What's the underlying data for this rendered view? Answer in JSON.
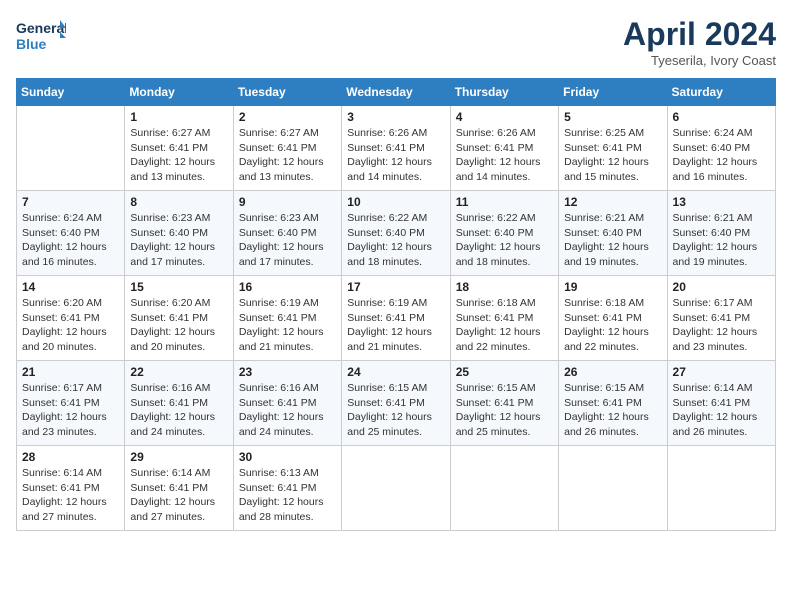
{
  "header": {
    "logo_line1": "General",
    "logo_line2": "Blue",
    "month": "April 2024",
    "location": "Tyeserila, Ivory Coast"
  },
  "weekdays": [
    "Sunday",
    "Monday",
    "Tuesday",
    "Wednesday",
    "Thursday",
    "Friday",
    "Saturday"
  ],
  "weeks": [
    [
      {
        "day": "",
        "info": ""
      },
      {
        "day": "1",
        "info": "Sunrise: 6:27 AM\nSunset: 6:41 PM\nDaylight: 12 hours\nand 13 minutes."
      },
      {
        "day": "2",
        "info": "Sunrise: 6:27 AM\nSunset: 6:41 PM\nDaylight: 12 hours\nand 13 minutes."
      },
      {
        "day": "3",
        "info": "Sunrise: 6:26 AM\nSunset: 6:41 PM\nDaylight: 12 hours\nand 14 minutes."
      },
      {
        "day": "4",
        "info": "Sunrise: 6:26 AM\nSunset: 6:41 PM\nDaylight: 12 hours\nand 14 minutes."
      },
      {
        "day": "5",
        "info": "Sunrise: 6:25 AM\nSunset: 6:41 PM\nDaylight: 12 hours\nand 15 minutes."
      },
      {
        "day": "6",
        "info": "Sunrise: 6:24 AM\nSunset: 6:40 PM\nDaylight: 12 hours\nand 16 minutes."
      }
    ],
    [
      {
        "day": "7",
        "info": "Sunrise: 6:24 AM\nSunset: 6:40 PM\nDaylight: 12 hours\nand 16 minutes."
      },
      {
        "day": "8",
        "info": "Sunrise: 6:23 AM\nSunset: 6:40 PM\nDaylight: 12 hours\nand 17 minutes."
      },
      {
        "day": "9",
        "info": "Sunrise: 6:23 AM\nSunset: 6:40 PM\nDaylight: 12 hours\nand 17 minutes."
      },
      {
        "day": "10",
        "info": "Sunrise: 6:22 AM\nSunset: 6:40 PM\nDaylight: 12 hours\nand 18 minutes."
      },
      {
        "day": "11",
        "info": "Sunrise: 6:22 AM\nSunset: 6:40 PM\nDaylight: 12 hours\nand 18 minutes."
      },
      {
        "day": "12",
        "info": "Sunrise: 6:21 AM\nSunset: 6:40 PM\nDaylight: 12 hours\nand 19 minutes."
      },
      {
        "day": "13",
        "info": "Sunrise: 6:21 AM\nSunset: 6:40 PM\nDaylight: 12 hours\nand 19 minutes."
      }
    ],
    [
      {
        "day": "14",
        "info": "Sunrise: 6:20 AM\nSunset: 6:41 PM\nDaylight: 12 hours\nand 20 minutes."
      },
      {
        "day": "15",
        "info": "Sunrise: 6:20 AM\nSunset: 6:41 PM\nDaylight: 12 hours\nand 20 minutes."
      },
      {
        "day": "16",
        "info": "Sunrise: 6:19 AM\nSunset: 6:41 PM\nDaylight: 12 hours\nand 21 minutes."
      },
      {
        "day": "17",
        "info": "Sunrise: 6:19 AM\nSunset: 6:41 PM\nDaylight: 12 hours\nand 21 minutes."
      },
      {
        "day": "18",
        "info": "Sunrise: 6:18 AM\nSunset: 6:41 PM\nDaylight: 12 hours\nand 22 minutes."
      },
      {
        "day": "19",
        "info": "Sunrise: 6:18 AM\nSunset: 6:41 PM\nDaylight: 12 hours\nand 22 minutes."
      },
      {
        "day": "20",
        "info": "Sunrise: 6:17 AM\nSunset: 6:41 PM\nDaylight: 12 hours\nand 23 minutes."
      }
    ],
    [
      {
        "day": "21",
        "info": "Sunrise: 6:17 AM\nSunset: 6:41 PM\nDaylight: 12 hours\nand 23 minutes."
      },
      {
        "day": "22",
        "info": "Sunrise: 6:16 AM\nSunset: 6:41 PM\nDaylight: 12 hours\nand 24 minutes."
      },
      {
        "day": "23",
        "info": "Sunrise: 6:16 AM\nSunset: 6:41 PM\nDaylight: 12 hours\nand 24 minutes."
      },
      {
        "day": "24",
        "info": "Sunrise: 6:15 AM\nSunset: 6:41 PM\nDaylight: 12 hours\nand 25 minutes."
      },
      {
        "day": "25",
        "info": "Sunrise: 6:15 AM\nSunset: 6:41 PM\nDaylight: 12 hours\nand 25 minutes."
      },
      {
        "day": "26",
        "info": "Sunrise: 6:15 AM\nSunset: 6:41 PM\nDaylight: 12 hours\nand 26 minutes."
      },
      {
        "day": "27",
        "info": "Sunrise: 6:14 AM\nSunset: 6:41 PM\nDaylight: 12 hours\nand 26 minutes."
      }
    ],
    [
      {
        "day": "28",
        "info": "Sunrise: 6:14 AM\nSunset: 6:41 PM\nDaylight: 12 hours\nand 27 minutes."
      },
      {
        "day": "29",
        "info": "Sunrise: 6:14 AM\nSunset: 6:41 PM\nDaylight: 12 hours\nand 27 minutes."
      },
      {
        "day": "30",
        "info": "Sunrise: 6:13 AM\nSunset: 6:41 PM\nDaylight: 12 hours\nand 28 minutes."
      },
      {
        "day": "",
        "info": ""
      },
      {
        "day": "",
        "info": ""
      },
      {
        "day": "",
        "info": ""
      },
      {
        "day": "",
        "info": ""
      }
    ]
  ]
}
